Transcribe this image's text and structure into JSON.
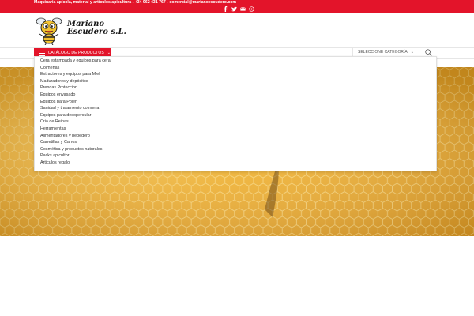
{
  "topbar": {
    "info": "Maquinaria apícola, material y artículos apicultura - +34 962 431 767 - comercial@marianoescudero.com",
    "social_icons": [
      "facebook-icon",
      "twitter-icon",
      "email-icon",
      "whatsapp-icon"
    ]
  },
  "logo": {
    "line1": "Mariano",
    "line2": "Escudero s.L."
  },
  "nav": {
    "catalog_label": "CATÁLOGO DE PRODUCTOS",
    "select_category_label": "SELECCIONE CATEGORÍA"
  },
  "menu": {
    "items": [
      "Cera estampada y equipos para cera",
      "Colmenas",
      "Extractores y equipos para Miel",
      "Maduradores y depósitos",
      "Prendas Proteccion",
      "Equipos envasado",
      "Equipos para Polen",
      "Sanidad y tratamiento colmena",
      "Equipos para desopercular",
      "Cria de Reinas",
      "Herramientas",
      "Alimentadores y bebedero",
      "Carretillas y Carros",
      "Cosmética y productos naturales",
      "Packs apicultor",
      "Articulos regalo"
    ]
  },
  "colors": {
    "brand_red": "#e3142a",
    "honey": "#eeb33c"
  }
}
